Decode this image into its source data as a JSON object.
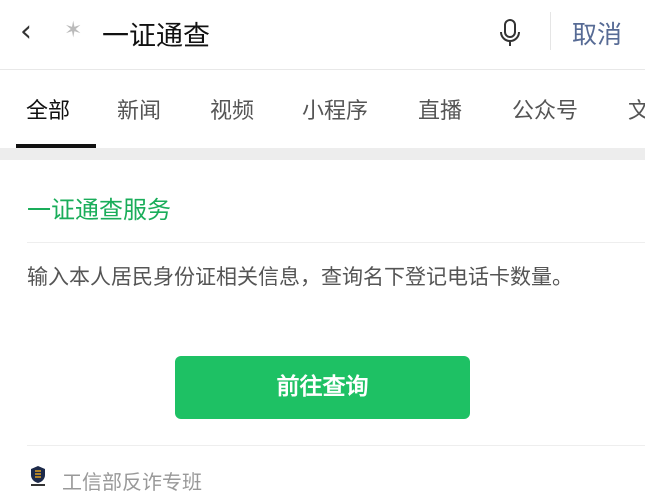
{
  "header": {
    "back_icon": "chevron-left",
    "search_icon": "sparkle",
    "query": "一证通查",
    "mic_icon": "microphone",
    "cancel": "取消"
  },
  "tabs": [
    {
      "label": "全部",
      "active": true
    },
    {
      "label": "新闻"
    },
    {
      "label": "视频"
    },
    {
      "label": "小程序"
    },
    {
      "label": "直播"
    },
    {
      "label": "公众号"
    },
    {
      "label": "文"
    }
  ],
  "card": {
    "title": "一证通查服务",
    "description": "输入本人居民身份证相关信息，查询名下登记电话卡数量。",
    "button": "前往查询",
    "source": "工信部反诈专班",
    "accent": "#1ec164"
  }
}
